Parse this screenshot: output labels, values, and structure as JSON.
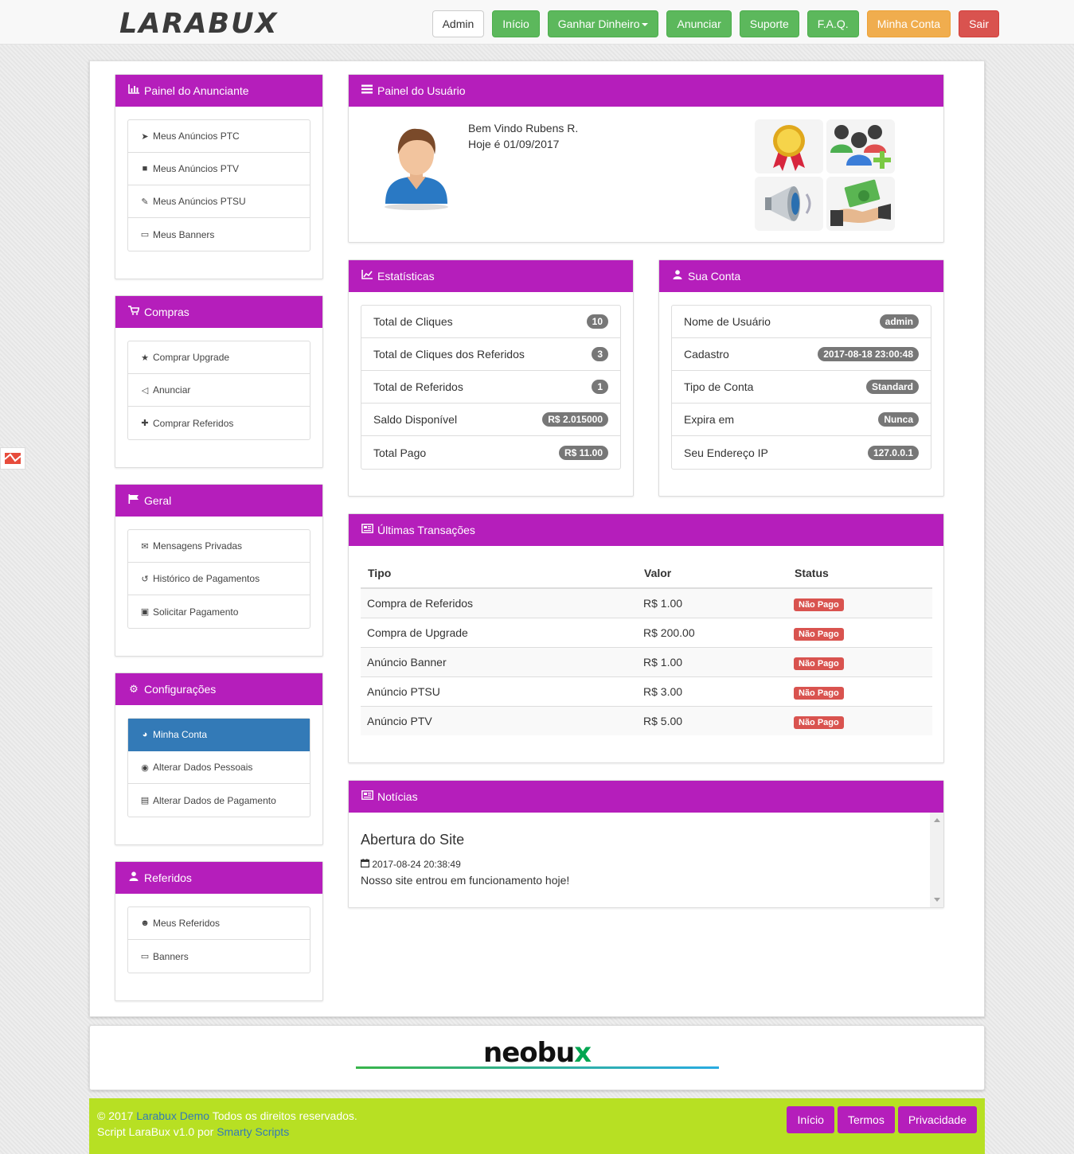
{
  "nav": {
    "logo": "LARABUX",
    "admin": "Admin",
    "inicio": "Início",
    "ganhar": "Ganhar Dinheiro",
    "anunciar": "Anunciar",
    "suporte": "Suporte",
    "faq": "F.A.Q.",
    "minha_conta": "Minha Conta",
    "sair": "Sair"
  },
  "sidebar": {
    "anunciante": {
      "title": "Painel do Anunciante",
      "items": [
        "Meus Anúncios PTC",
        "Meus Anúncios PTV",
        "Meus Anúncios PTSU",
        "Meus Banners"
      ]
    },
    "compras": {
      "title": "Compras",
      "items": [
        "Comprar Upgrade",
        "Anunciar",
        "Comprar Referidos"
      ]
    },
    "geral": {
      "title": "Geral",
      "items": [
        "Mensagens Privadas",
        "Histórico de Pagamentos",
        "Solicitar Pagamento"
      ]
    },
    "config": {
      "title": "Configurações",
      "items": [
        "Minha Conta",
        "Alterar Dados Pessoais",
        "Alterar Dados de Pagamento"
      ]
    },
    "referidos": {
      "title": "Referidos",
      "items": [
        "Meus Referidos",
        "Banners"
      ]
    }
  },
  "user_panel": {
    "title": "Painel do Usuário",
    "welcome": "Bem Vindo Rubens R.",
    "today": "Hoje é 01/09/2017"
  },
  "stats": {
    "title": "Estatísticas",
    "rows": [
      {
        "label": "Total de Cliques",
        "value": "10"
      },
      {
        "label": "Total de Cliques dos Referidos",
        "value": "3"
      },
      {
        "label": "Total de Referidos",
        "value": "1"
      },
      {
        "label": "Saldo Disponível",
        "value": "R$ 2.015000"
      },
      {
        "label": "Total Pago",
        "value": "R$ 11.00"
      }
    ]
  },
  "account": {
    "title": "Sua Conta",
    "rows": [
      {
        "label": "Nome de Usuário",
        "value": "admin"
      },
      {
        "label": "Cadastro",
        "value": "2017-08-18 23:00:48"
      },
      {
        "label": "Tipo de Conta",
        "value": "Standard"
      },
      {
        "label": "Expira em",
        "value": "Nunca"
      },
      {
        "label": "Seu Endereço IP",
        "value": "127.0.0.1"
      }
    ]
  },
  "transactions": {
    "title": "Últimas Transações",
    "headers": {
      "tipo": "Tipo",
      "valor": "Valor",
      "status": "Status"
    },
    "rows": [
      {
        "tipo": "Compra de Referidos",
        "valor": "R$ 1.00",
        "status": "Não Pago"
      },
      {
        "tipo": "Compra de Upgrade",
        "valor": "R$ 200.00",
        "status": "Não Pago"
      },
      {
        "tipo": "Anúncio Banner",
        "valor": "R$ 1.00",
        "status": "Não Pago"
      },
      {
        "tipo": "Anúncio PTSU",
        "valor": "R$ 3.00",
        "status": "Não Pago"
      },
      {
        "tipo": "Anúncio PTV",
        "valor": "R$ 5.00",
        "status": "Não Pago"
      }
    ]
  },
  "news": {
    "title": "Notícias",
    "item_title": "Abertura do Site",
    "item_date": "2017-08-24 20:38:49",
    "item_text": "Nosso site entrou em funcionamento hoje!"
  },
  "sponsor": {
    "brand_a": "neobu",
    "brand_b": "x"
  },
  "footer": {
    "copy_prefix": "© 2017",
    "site_link": "Larabux Demo",
    "rights": "Todos os direitos reservados.",
    "script_prefix": "Script LaraBux v1.0 por",
    "author_link": "Smarty Scripts",
    "btn_inicio": "Início",
    "btn_termos": "Termos",
    "btn_privacidade": "Privacidade"
  },
  "colors": {
    "panel_heading": "#b51ebb",
    "nav_green": "#5cb85c",
    "nav_orange": "#f0ad4e",
    "nav_red": "#d9534f",
    "active_item": "#337ab7",
    "footer": "#b7e023"
  }
}
